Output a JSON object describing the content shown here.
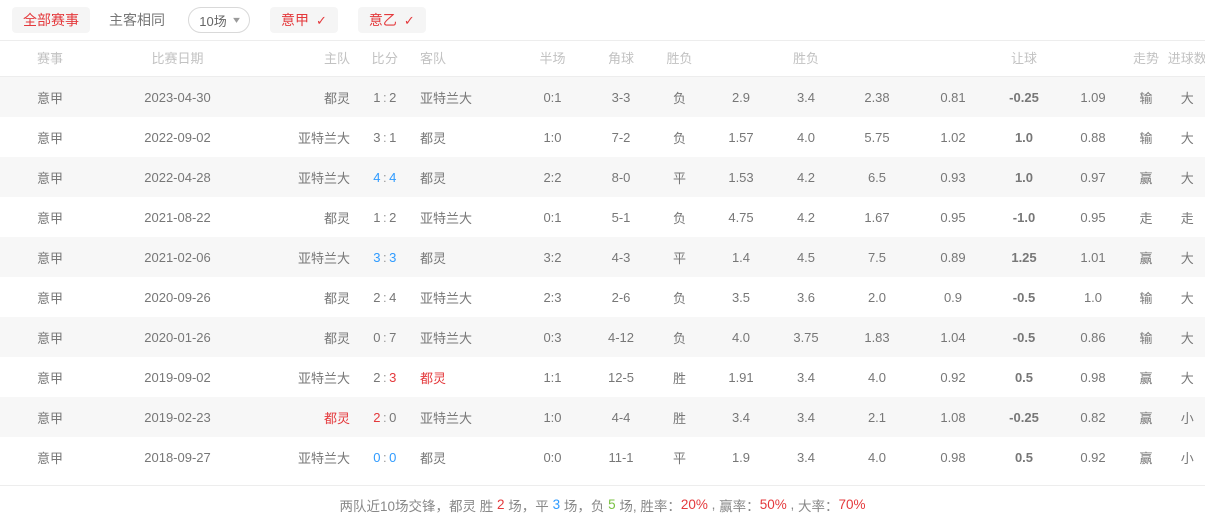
{
  "toolbar": {
    "all_matches_label": "全部赛事",
    "home_away_same_label": "主客相同",
    "count_select_value": "10场",
    "count_select_caret": "chevron-down-icon",
    "league_tags": [
      {
        "label": "意甲",
        "checked": true
      },
      {
        "label": "意乙",
        "checked": true
      }
    ]
  },
  "table": {
    "headers": {
      "league": "赛事",
      "date": "比赛日期",
      "home": "主队",
      "score": "比分",
      "away": "客队",
      "half": "半场",
      "corner": "角球",
      "result": "胜负",
      "odds_group": "胜负",
      "handicap_group": "让球",
      "trend": "走势",
      "goals": "进球数"
    },
    "rows": [
      {
        "league": "意甲",
        "date": "2023-04-30",
        "home": "都灵",
        "home_color": "gray",
        "score_home": "1",
        "score_away": "2",
        "score_color": "gray",
        "away": "亚特兰大",
        "away_color": "gray",
        "half": "0:1",
        "corner": "3-3",
        "result": "负",
        "result_color": "green",
        "o1": "2.9",
        "o2": "3.4",
        "o3": "2.38",
        "h1": "0.81",
        "h2": "-0.25",
        "h3": "1.09",
        "trend": "输",
        "trend_color": "green",
        "goals": "大",
        "goals_color": "red"
      },
      {
        "league": "意甲",
        "date": "2022-09-02",
        "home": "亚特兰大",
        "home_color": "gray",
        "score_home": "3",
        "score_away": "1",
        "score_color": "gray",
        "away": "都灵",
        "away_color": "gray",
        "half": "1:0",
        "corner": "7-2",
        "result": "负",
        "result_color": "green",
        "o1": "1.57",
        "o2": "4.0",
        "o3": "5.75",
        "h1": "1.02",
        "h2": "1.0",
        "h3": "0.88",
        "trend": "输",
        "trend_color": "green",
        "goals": "大",
        "goals_color": "red"
      },
      {
        "league": "意甲",
        "date": "2022-04-28",
        "home": "亚特兰大",
        "home_color": "gray",
        "score_home": "4",
        "score_away": "4",
        "score_color": "blue",
        "away": "都灵",
        "away_color": "gray",
        "half": "2:2",
        "corner": "8-0",
        "result": "平",
        "result_color": "blue",
        "o1": "1.53",
        "o2": "4.2",
        "o3": "6.5",
        "h1": "0.93",
        "h2": "1.0",
        "h3": "0.97",
        "trend": "赢",
        "trend_color": "red",
        "goals": "大",
        "goals_color": "red"
      },
      {
        "league": "意甲",
        "date": "2021-08-22",
        "home": "都灵",
        "home_color": "gray",
        "score_home": "1",
        "score_away": "2",
        "score_color": "gray",
        "away": "亚特兰大",
        "away_color": "gray",
        "half": "0:1",
        "corner": "5-1",
        "result": "负",
        "result_color": "green",
        "o1": "4.75",
        "o2": "4.2",
        "o3": "1.67",
        "h1": "0.95",
        "h2": "-1.0",
        "h3": "0.95",
        "trend": "走",
        "trend_color": "blue",
        "goals": "走",
        "goals_color": "blue"
      },
      {
        "league": "意甲",
        "date": "2021-02-06",
        "home": "亚特兰大",
        "home_color": "gray",
        "score_home": "3",
        "score_away": "3",
        "score_color": "blue",
        "away": "都灵",
        "away_color": "gray",
        "half": "3:2",
        "corner": "4-3",
        "result": "平",
        "result_color": "blue",
        "o1": "1.4",
        "o2": "4.5",
        "o3": "7.5",
        "h1": "0.89",
        "h2": "1.25",
        "h3": "1.01",
        "trend": "赢",
        "trend_color": "red",
        "goals": "大",
        "goals_color": "red"
      },
      {
        "league": "意甲",
        "date": "2020-09-26",
        "home": "都灵",
        "home_color": "gray",
        "score_home": "2",
        "score_away": "4",
        "score_color": "gray",
        "away": "亚特兰大",
        "away_color": "gray",
        "half": "2:3",
        "corner": "2-6",
        "result": "负",
        "result_color": "green",
        "o1": "3.5",
        "o2": "3.6",
        "o3": "2.0",
        "h1": "0.9",
        "h2": "-0.5",
        "h3": "1.0",
        "trend": "输",
        "trend_color": "green",
        "goals": "大",
        "goals_color": "red"
      },
      {
        "league": "意甲",
        "date": "2020-01-26",
        "home": "都灵",
        "home_color": "gray",
        "score_home": "0",
        "score_away": "7",
        "score_color": "gray",
        "away": "亚特兰大",
        "away_color": "gray",
        "half": "0:3",
        "corner": "4-12",
        "result": "负",
        "result_color": "green",
        "o1": "4.0",
        "o2": "3.75",
        "o3": "1.83",
        "h1": "1.04",
        "h2": "-0.5",
        "h3": "0.86",
        "trend": "输",
        "trend_color": "green",
        "goals": "大",
        "goals_color": "red"
      },
      {
        "league": "意甲",
        "date": "2019-09-02",
        "home": "亚特兰大",
        "home_color": "gray",
        "score_home": "2",
        "score_away": "3",
        "score_color": "split-red-away",
        "away": "都灵",
        "away_color": "red",
        "half": "1:1",
        "corner": "12-5",
        "result": "胜",
        "result_color": "red",
        "o1": "1.91",
        "o2": "3.4",
        "o3": "4.0",
        "h1": "0.92",
        "h2": "0.5",
        "h3": "0.98",
        "trend": "赢",
        "trend_color": "red",
        "goals": "大",
        "goals_color": "red"
      },
      {
        "league": "意甲",
        "date": "2019-02-23",
        "home": "都灵",
        "home_color": "red",
        "score_home": "2",
        "score_away": "0",
        "score_color": "split-red-home",
        "away": "亚特兰大",
        "away_color": "gray",
        "half": "1:0",
        "corner": "4-4",
        "result": "胜",
        "result_color": "red",
        "o1": "3.4",
        "o2": "3.4",
        "o3": "2.1",
        "h1": "1.08",
        "h2": "-0.25",
        "h3": "0.82",
        "trend": "赢",
        "trend_color": "red",
        "goals": "小",
        "goals_color": "green"
      },
      {
        "league": "意甲",
        "date": "2018-09-27",
        "home": "亚特兰大",
        "home_color": "gray",
        "score_home": "0",
        "score_away": "0",
        "score_color": "blue",
        "away": "都灵",
        "away_color": "gray",
        "half": "0:0",
        "corner": "11-1",
        "result": "平",
        "result_color": "blue",
        "o1": "1.9",
        "o2": "3.4",
        "o3": "4.0",
        "h1": "0.98",
        "h2": "0.5",
        "h3": "0.92",
        "trend": "赢",
        "trend_color": "red",
        "goals": "小",
        "goals_color": "green"
      }
    ]
  },
  "footer": {
    "prefix": "两队近10场交锋，",
    "team": "都灵",
    "win_label": " 胜 ",
    "win_count": "2",
    "win_unit": " 场，",
    "draw_label": "平 ",
    "draw_count": "3",
    "draw_unit": " 场，",
    "lose_label": "负 ",
    "lose_count": "5",
    "lose_unit": " 场, ",
    "winrate_label": "胜率：",
    "winrate_value": "20%",
    "sep1": " , ",
    "yingrate_label": "赢率：",
    "yingrate_value": "50%",
    "sep2": " , ",
    "bigrate_label": "大率：",
    "bigrate_value": "70%"
  },
  "colors": {
    "red": "#e4393c",
    "green": "#7ac143",
    "blue": "#2f9bff",
    "gray": "#777777"
  }
}
